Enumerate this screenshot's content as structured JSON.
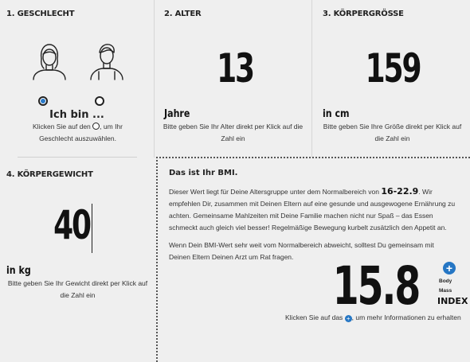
{
  "gender": {
    "step_label": "1. GESCHLECHT",
    "heading": "Ich bin ...",
    "hint_before": "Klicken Sie auf den",
    "hint_after": ", um Ihr Geschlecht auszuwählen.",
    "options": [
      {
        "icon": "female-avatar-icon",
        "selected": true
      },
      {
        "icon": "male-avatar-icon",
        "selected": false
      }
    ]
  },
  "age": {
    "step_label": "2. ALTER",
    "value": "13",
    "unit": "Jahre",
    "hint": "Bitte geben Sie Ihr Alter direkt per Klick auf die Zahl ein"
  },
  "height": {
    "step_label": "3. KÖRPERGRÖSSE",
    "value": "159",
    "unit": "in cm",
    "hint": "Bitte geben Sie Ihre Größe direkt per Klick auf die Zahl ein"
  },
  "weight": {
    "step_label": "4. KÖRPERGEWICHT",
    "value": "40",
    "unit": "in kg",
    "hint": "Bitte geben Sie Ihr Gewicht direkt per Klick auf die Zahl ein"
  },
  "bmi": {
    "title": "Das ist Ihr BMI.",
    "para1_before": "Dieser Wert liegt für Deine Altersgruppe unter dem Normalbereich von",
    "range": "16-22.9",
    "para1_after": ". Wir empfehlen Dir, zusammen mit Deinen Eltern auf eine gesunde und ausgewogene Ernährung zu achten. Gemeinsame Mahlzeiten mit Deine Familie machen nicht nur Spaß – das Essen schmeckt auch gleich viel besser! Regelmäßige Bewegung kurbelt zusätzlich den Appetit an.",
    "para2": "Wenn Dein BMI-Wert sehr weit vom Normalbereich abweicht, solltest Du gemeinsam mit Deinen Eltern Deinen Arzt um Rat fragen.",
    "value": "15.8",
    "label_line1": "Body",
    "label_line2": "Mass",
    "label_line3": "INDEX",
    "info_before": "Klicken Sie auf das",
    "info_after": ", um mehr Informationen zu erhalten",
    "accent_color": "#2576c4"
  }
}
